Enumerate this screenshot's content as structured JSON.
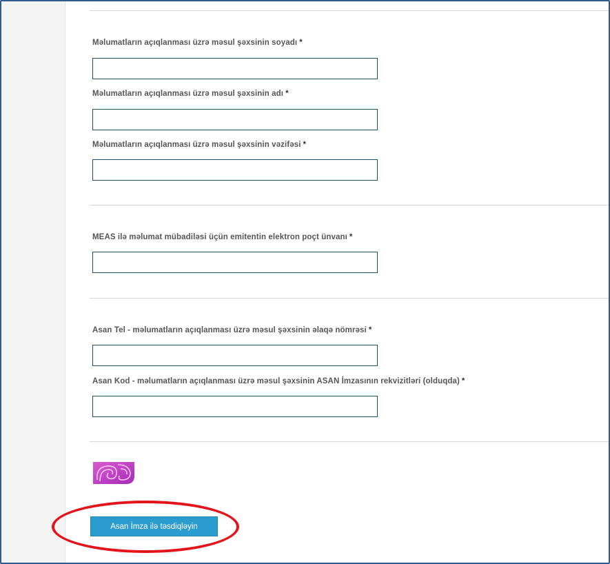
{
  "form": {
    "fields": [
      {
        "label": "Məlumatların açıqlanması üzrə məsul şəxsinin soyadı",
        "required": "*",
        "value": "",
        "placeholder": ""
      },
      {
        "label": "Məlumatların açıqlanması üzrə məsul şəxsinin adı",
        "required": "*",
        "value": "",
        "placeholder": ""
      },
      {
        "label": "Məlumatların açıqlanması üzrə məsul şəxsinin vəzifəsi",
        "required": "*",
        "value": "",
        "placeholder": ""
      },
      {
        "label": "MEAS ilə məlumat mübadiləsi üçün emitentin elektron poçt ünvanı",
        "required": "*",
        "value": "",
        "placeholder": ""
      },
      {
        "label": "Asan Tel - məlumatların açıqlanması üzrə məsul şəxsinin əlaqə nömrəsi",
        "required": "*",
        "value": "",
        "placeholder": ""
      },
      {
        "label": "Asan Kod - məlumatların açıqlanması üzrə məsul şəxsinin ASAN İmzasının rekvizitləri (olduqda)",
        "required": "*",
        "value": "",
        "placeholder": ""
      }
    ],
    "submit_label": "Asan İmza ilə təsdiqləyin"
  },
  "logo": {
    "icon": "asan-imza-logo-icon"
  },
  "colors": {
    "button": "#2b9ccf",
    "highlight": "#e3141b",
    "input_border": "#1b4f66",
    "frame_border": "#2e5a8e"
  }
}
